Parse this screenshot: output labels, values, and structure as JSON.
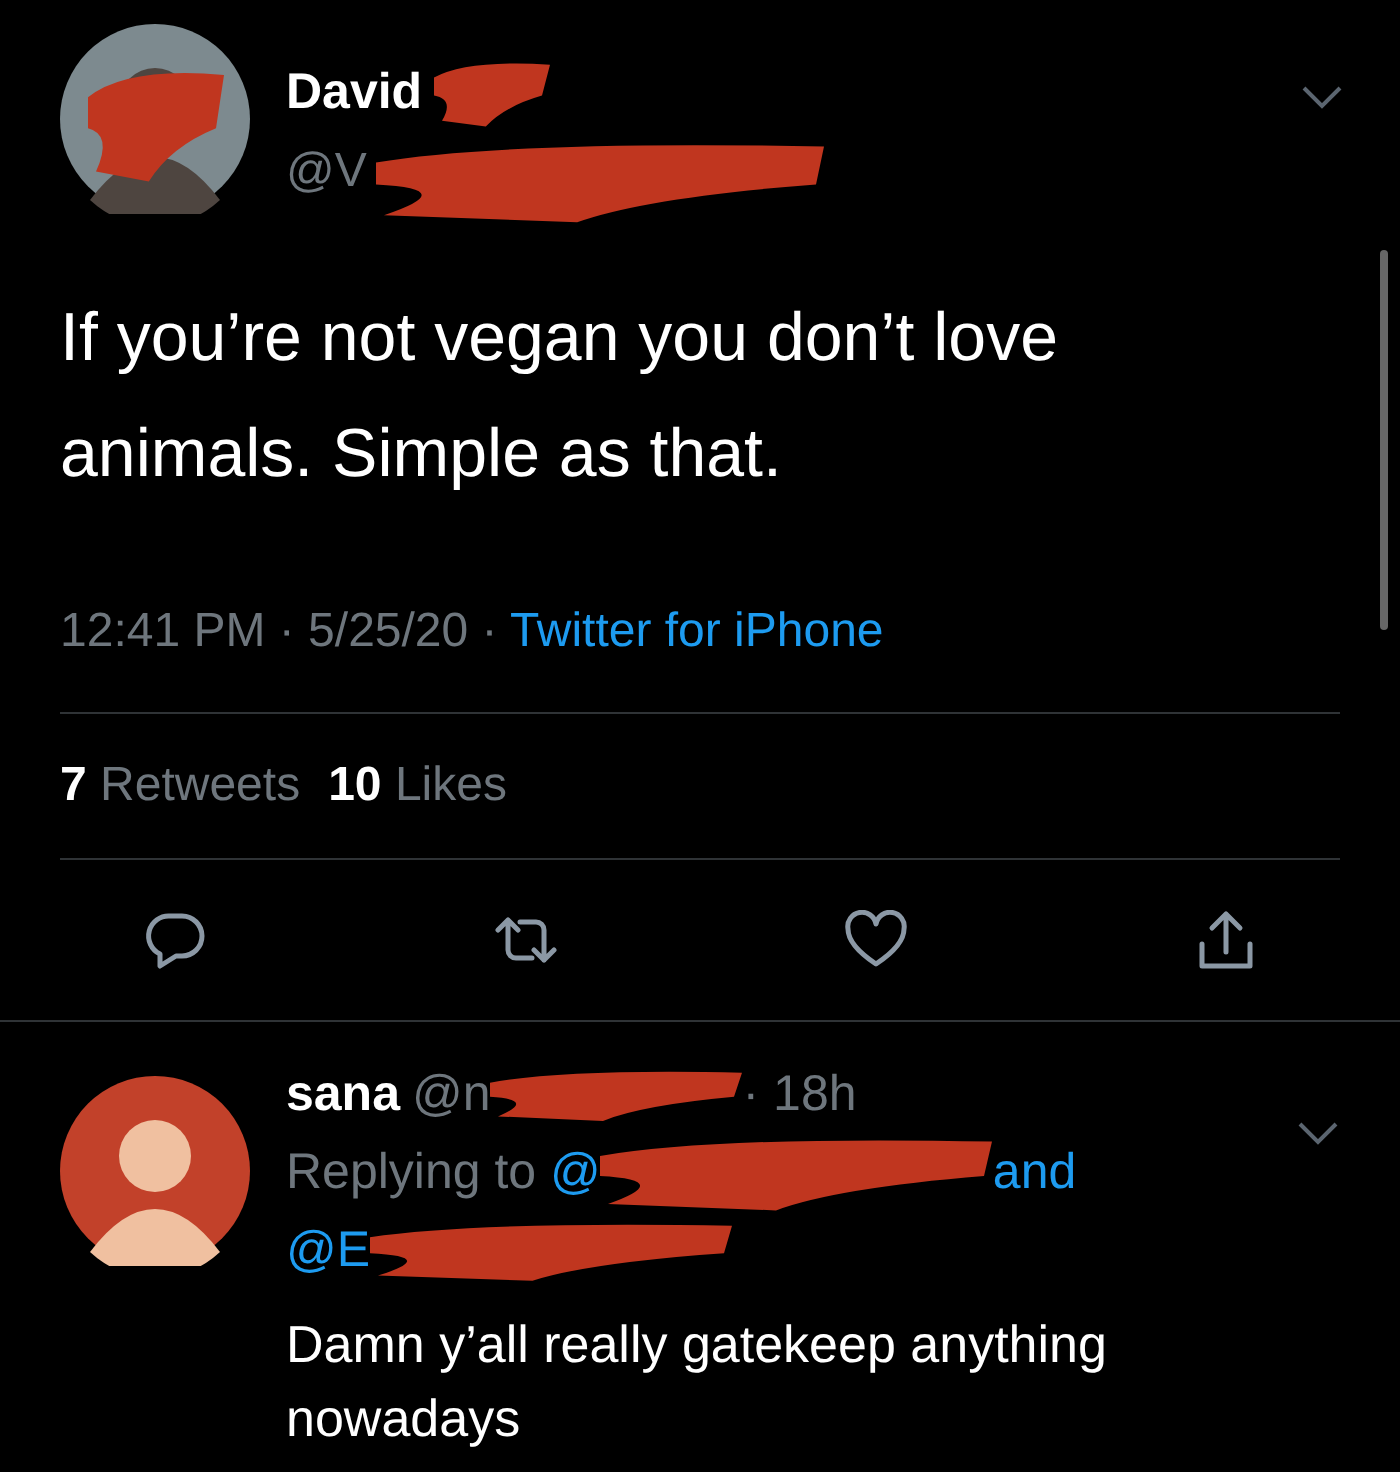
{
  "tweet": {
    "author": {
      "name": "David",
      "handle": "@V"
    },
    "text": "If you’re not vegan you don’t love animals. Simple as that.",
    "separator": "·",
    "time": "12:41 PM",
    "date": "5/25/20",
    "source": "Twitter for iPhone",
    "stats": [
      {
        "count": "7",
        "label": "Retweets"
      },
      {
        "count": "10",
        "label": "Likes"
      }
    ],
    "actions": [
      {
        "kind": "reply"
      },
      {
        "kind": "retweet"
      },
      {
        "kind": "like"
      },
      {
        "kind": "share"
      }
    ]
  },
  "reply": {
    "author": {
      "name": "sana",
      "handle": "@n"
    },
    "separator": "·",
    "age": "18h",
    "replying_label": "Replying to",
    "first_mention": "@",
    "joiner": "and",
    "second_mention": "@E",
    "text": "Damn y’all really gatekeep anything nowadays"
  }
}
